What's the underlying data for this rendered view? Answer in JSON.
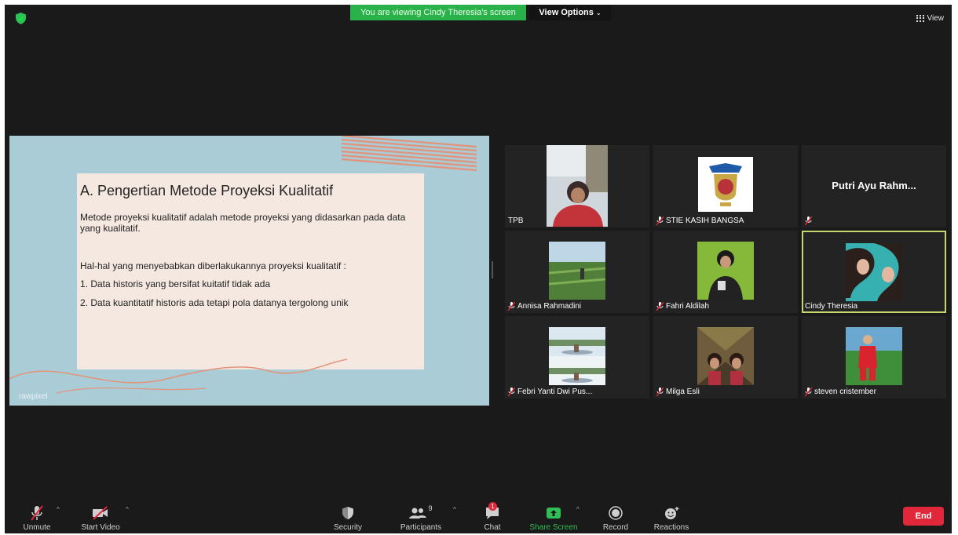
{
  "topbar": {
    "viewing_banner": "You are viewing Cindy Theresia's screen",
    "view_options": "View Options",
    "view": "View"
  },
  "slide": {
    "title": "A. Pengertian Metode Proyeksi Kualitatif",
    "p1": "Metode proyeksi kualitatif adalah metode proyeksi yang didasarkan pada data yang kualitatif.",
    "p2": "Hal-hal yang menyebabkan diberlakukannya proyeksi kualitatif :",
    "p3": "1. Data historis yang bersifat kuitatif tidak ada",
    "p4": "2. Data kuantitatif historis ada tetapi pola datanya tergolong unik",
    "brand": "rawpixel"
  },
  "participants": [
    {
      "name": "TPB",
      "muted": false
    },
    {
      "name": "STIE KASIH BANGSA",
      "muted": true
    },
    {
      "name": "Putri Ayu Rahm...",
      "label": "",
      "muted": true
    },
    {
      "name": "Annisa Rahmadini",
      "muted": true
    },
    {
      "name": "Fahri Aldilah",
      "muted": true
    },
    {
      "name": "Cindy Theresia",
      "muted": false
    },
    {
      "name": "Febri Yanti Dwi Pus...",
      "muted": true
    },
    {
      "name": "Milga Esli",
      "muted": true
    },
    {
      "name": "steven cristember",
      "muted": true
    }
  ],
  "toolbar": {
    "unmute": "Unmute",
    "start_video": "Start Video",
    "security": "Security",
    "participants": "Participants",
    "participants_count": "9",
    "chat": "Chat",
    "chat_badge": "1",
    "share_screen": "Share Screen",
    "record": "Record",
    "reactions": "Reactions",
    "end": "End"
  },
  "colors": {
    "app_bg": "#1a1a1a",
    "banner_green": "#2ab24a",
    "active_speaker": "#c6d96e",
    "end_red": "#e0283a",
    "slide_bg": "#a9ccd6"
  }
}
